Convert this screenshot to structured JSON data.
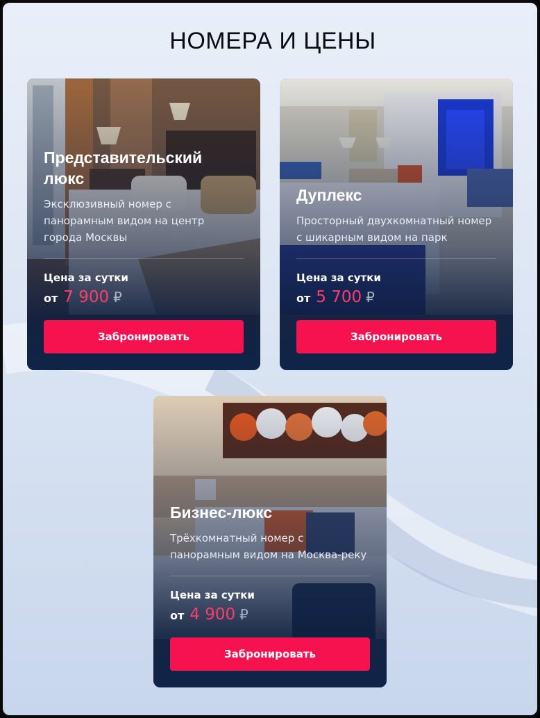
{
  "section": {
    "title": "НОМЕРА И ЦЕНЫ"
  },
  "rooms": [
    {
      "name": "Представительский люкс",
      "description": "Эксклюзивный номер с панорамным видом на центр города Москвы",
      "price_label": "Цена за сутки",
      "price_prefix": "от",
      "price": "7 900",
      "currency": "₽",
      "button": "Забронировать",
      "image": "hotel-room-photo-bed-lamps"
    },
    {
      "name": "Дуплекс",
      "description": "Просторный двухкомнатный номер с шикарным видом на парк",
      "price_label": "Цена за сутки",
      "price_prefix": "от",
      "price": "5 700",
      "currency": "₽",
      "button": "Забронировать",
      "image": "hotel-room-photo-window-night"
    },
    {
      "name": "Бизнес-люкс",
      "description": "Трёхкомнатный номер с панорамным видом на Москва-реку",
      "price_label": "Цена за сутки",
      "price_prefix": "от",
      "price": "4 900",
      "currency": "₽",
      "button": "Забронировать",
      "image": "hotel-room-photo-flower-art"
    }
  ],
  "colors": {
    "accent": "#f5124f",
    "price": "#ff3d6a",
    "card_bottom": "#0f2449"
  }
}
